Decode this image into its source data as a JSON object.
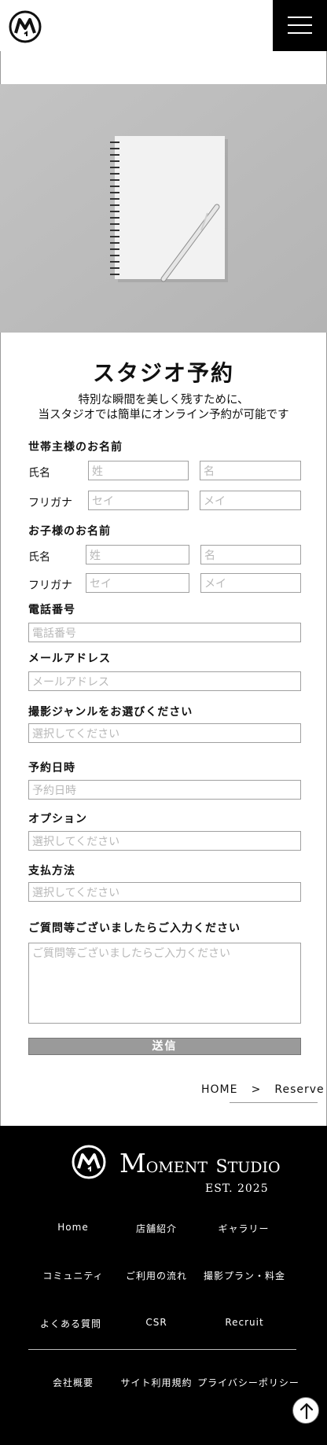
{
  "page": {
    "title": "スタジオ予約",
    "lead_line1": "特別な瞬間を美しく残すために、",
    "lead_line2": "当スタジオでは簡単にオンライン予約が可能です"
  },
  "form": {
    "householder": {
      "heading": "世帯主様のお名前",
      "name_label": "氏名",
      "kana_label": "フリガナ",
      "last_placeholder": "姓",
      "first_placeholder": "名",
      "last_kana_placeholder": "セイ",
      "first_kana_placeholder": "メイ"
    },
    "child": {
      "heading": "お子様のお名前",
      "name_label": "氏名",
      "kana_label": "フリガナ",
      "last_placeholder": "姓",
      "first_placeholder": "名",
      "last_kana_placeholder": "セイ",
      "first_kana_placeholder": "メイ"
    },
    "phone": {
      "heading": "電話番号",
      "placeholder": "電話番号"
    },
    "email": {
      "heading": "メールアドレス",
      "placeholder": "メールアドレス"
    },
    "genre": {
      "heading": "撮影ジャンルをお選びください",
      "placeholder": "選択してください"
    },
    "date": {
      "heading": "予約日時",
      "placeholder": "予約日時"
    },
    "option": {
      "heading": "オプション",
      "placeholder": "選択してください"
    },
    "payment": {
      "heading": "支払方法",
      "placeholder": "選択してください"
    },
    "inquiry": {
      "heading": "ご質問等ございましたらご入力ください",
      "placeholder": "ご質問等ございましたらご入力ください"
    },
    "submit_label": "送信"
  },
  "breadcrumb": {
    "home": "HOME",
    "separator": ">",
    "current": "Reserve"
  },
  "footer": {
    "brand_m": "M",
    "brand_oment": "OMENT",
    "brand_s": "S",
    "brand_tudio": "TUDIO",
    "est": "EST. 2025",
    "nav": [
      "Home",
      "店舗紹介",
      "ギャラリー",
      "コミュニティ",
      "ご利用の流れ",
      "撮影プラン・料金",
      "よくある質問",
      "CSR",
      "Recruit"
    ],
    "legal": [
      "会社概要",
      "サイト利用規約",
      "プライバシーポリシー"
    ]
  },
  "icons": {
    "logo": "moment-studio-logo-icon",
    "menu": "hamburger-menu-icon",
    "totop": "arrow-up-icon"
  },
  "colors": {
    "header_bg": "#ffffff",
    "menu_bg": "#000000",
    "footer_bg": "#000000",
    "submit_bg": "#9a9a9a"
  }
}
